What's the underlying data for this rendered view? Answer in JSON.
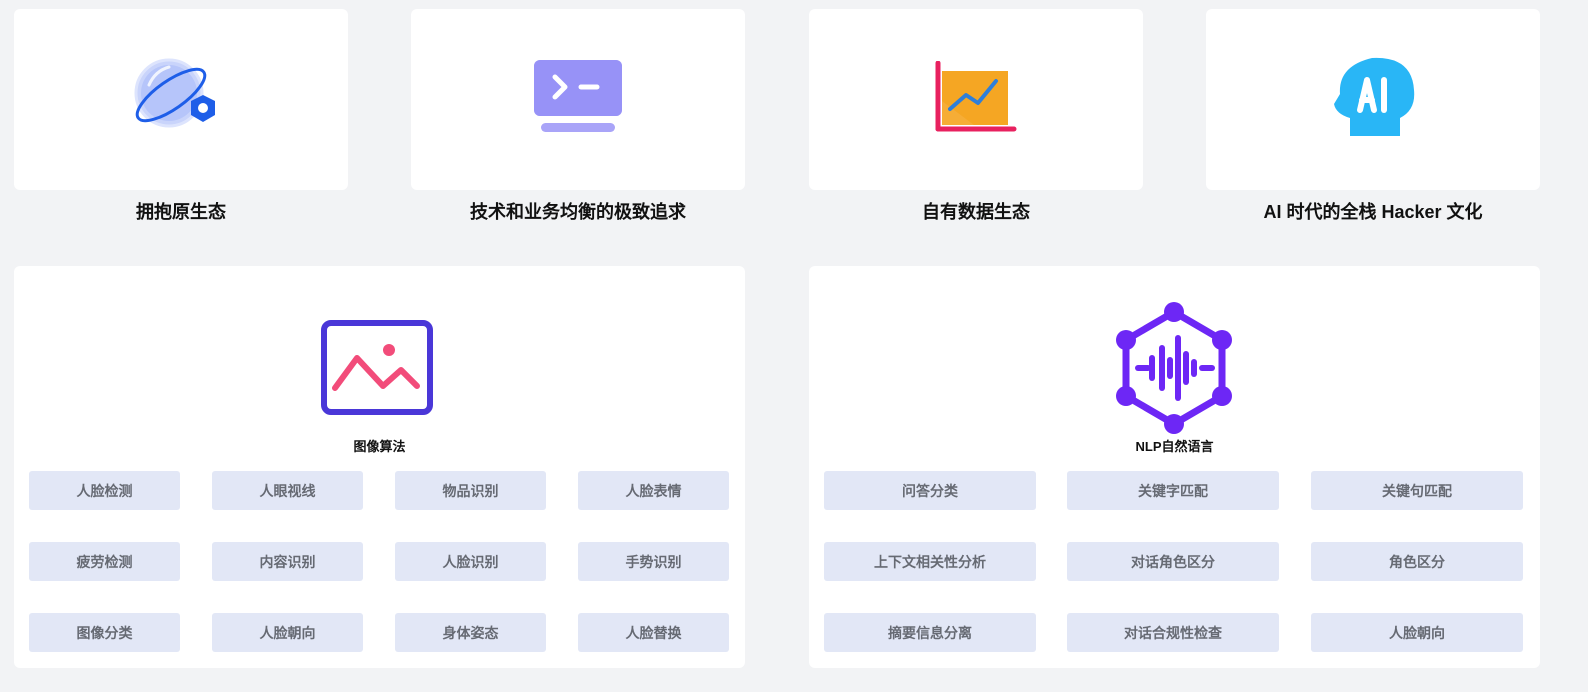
{
  "features": [
    {
      "title": "拥抱原生态",
      "icon": "planet-gear-icon"
    },
    {
      "title": "技术和业务均衡的极致追求",
      "icon": "terminal-monitor-icon"
    },
    {
      "title": "自有数据生态",
      "icon": "line-chart-icon"
    },
    {
      "title": "AI 时代的全栈 Hacker 文化",
      "icon": "ai-head-icon"
    }
  ],
  "image_algo": {
    "title": "图像算法",
    "icon": "image-picture-icon",
    "tags": [
      "人脸检测",
      "人眼视线",
      "物品识别",
      "人脸表情",
      "疲劳检测",
      "内容识别",
      "人脸识别",
      "手势识别",
      "图像分类",
      "人脸朝向",
      "身体姿态",
      "人脸替换"
    ]
  },
  "nlp": {
    "title": "NLP自然语言",
    "icon": "nlp-hexagon-waveform-icon",
    "tags": [
      "问答分类",
      "关键字匹配",
      "关键句匹配",
      "上下文相关性分析",
      "对话角色区分",
      "角色区分",
      "摘要信息分离",
      "对话合规性检查",
      "人脸朝向"
    ]
  },
  "colors": {
    "background": "#f2f3f5",
    "card": "#ffffff",
    "tag_bg": "#e2e7f6",
    "tag_text": "#666a73",
    "planet_blue": "#1e5ee8",
    "terminal_purple": "#8b85f5",
    "chart_orange": "#f5a623",
    "chart_axis_pink": "#e8215f",
    "ai_cyan": "#29b6f6",
    "image_purple": "#4a37d8",
    "image_pink": "#f24c7a",
    "nlp_violet": "#6d27f5"
  }
}
